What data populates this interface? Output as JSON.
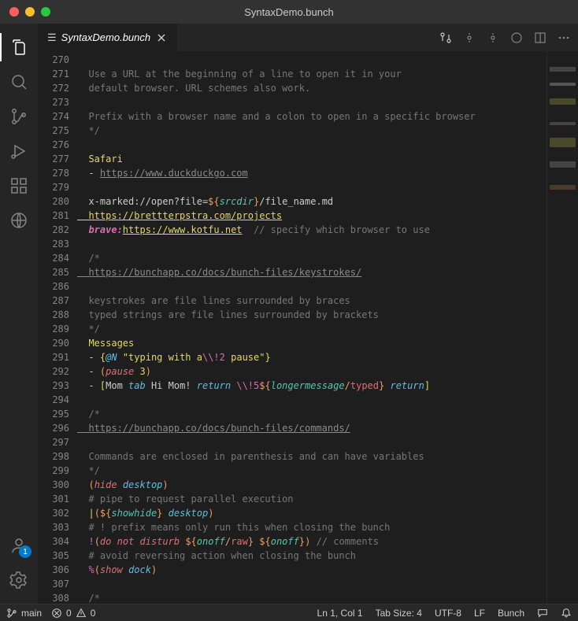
{
  "window": {
    "title": "SyntaxDemo.bunch"
  },
  "tab": {
    "label": "SyntaxDemo.bunch"
  },
  "account": {
    "badge": "1"
  },
  "gutter_start": 270,
  "code_lines": [
    [
      {
        "c": "c-plain",
        "t": "  "
      }
    ],
    [
      {
        "c": "c-comment",
        "t": "  Use a URL at the beginning of a line to open it in your"
      }
    ],
    [
      {
        "c": "c-comment",
        "t": "  default browser. URL schemes also work."
      }
    ],
    [
      {
        "c": "c-plain",
        "t": ""
      }
    ],
    [
      {
        "c": "c-comment",
        "t": "  Prefix with a browser name and a colon to open in a specific browser"
      }
    ],
    [
      {
        "c": "c-comment",
        "t": "  */"
      }
    ],
    [
      {
        "c": "c-plain",
        "t": ""
      }
    ],
    [
      {
        "c": "c-app",
        "t": "  Safari"
      }
    ],
    [
      {
        "c": "c-dash",
        "t": "  - "
      },
      {
        "c": "c-url",
        "t": "https://www.duckduckgo.com"
      }
    ],
    [
      {
        "c": "c-plain",
        "t": ""
      }
    ],
    [
      {
        "c": "c-plain",
        "t": "  x-marked://open?file="
      },
      {
        "c": "c-orange",
        "t": "${"
      },
      {
        "c": "c-var",
        "t": "srcdir"
      },
      {
        "c": "c-orange",
        "t": "}"
      },
      {
        "c": "c-plain",
        "t": "/file_name.md"
      }
    ],
    [
      {
        "c": "c-yellowunder",
        "t": "  https://brettterpstra.com/projects"
      }
    ],
    [
      {
        "c": "c-pinkital c-bold",
        "t": "  brave:"
      },
      {
        "c": "c-yellowunder",
        "t": "https://www.kotfu.net"
      },
      {
        "c": "c-plain",
        "t": "  "
      },
      {
        "c": "c-comment",
        "t": "// specify which browser to use"
      }
    ],
    [
      {
        "c": "c-plain",
        "t": ""
      }
    ],
    [
      {
        "c": "c-comment",
        "t": "  /*"
      }
    ],
    [
      {
        "c": "c-url",
        "t": "  https://bunchapp.co/docs/bunch-files/keystrokes/"
      }
    ],
    [
      {
        "c": "c-plain",
        "t": ""
      }
    ],
    [
      {
        "c": "c-comment",
        "t": "  keystrokes are file lines surrounded by braces"
      }
    ],
    [
      {
        "c": "c-comment",
        "t": "  typed strings are file lines surrounded by brackets"
      }
    ],
    [
      {
        "c": "c-comment",
        "t": "  */"
      }
    ],
    [
      {
        "c": "c-app",
        "t": "  Messages"
      }
    ],
    [
      {
        "c": "c-dash",
        "t": "  - "
      },
      {
        "c": "c-yellow",
        "t": "{"
      },
      {
        "c": "c-cyanital",
        "t": "@N "
      },
      {
        "c": "c-yellow",
        "t": "\"typing with a"
      },
      {
        "c": "c-pink",
        "t": "\\\\!2"
      },
      {
        "c": "c-yellow",
        "t": " pause\""
      },
      {
        "c": "c-yellow",
        "t": "}"
      }
    ],
    [
      {
        "c": "c-dash",
        "t": "  - "
      },
      {
        "c": "c-orange",
        "t": "("
      },
      {
        "c": "c-redbold c-ital",
        "t": "pause"
      },
      {
        "c": "c-plain",
        "t": " "
      },
      {
        "c": "c-yellow",
        "t": "3"
      },
      {
        "c": "c-orange",
        "t": ")"
      }
    ],
    [
      {
        "c": "c-dash",
        "t": "  - "
      },
      {
        "c": "c-yellow",
        "t": "["
      },
      {
        "c": "c-plain",
        "t": "Mom "
      },
      {
        "c": "c-cyanital",
        "t": "tab"
      },
      {
        "c": "c-plain",
        "t": " Hi Mom! "
      },
      {
        "c": "c-cyanital",
        "t": "return"
      },
      {
        "c": "c-plain",
        "t": " "
      },
      {
        "c": "c-pink",
        "t": "\\\\!5"
      },
      {
        "c": "c-orange",
        "t": "${"
      },
      {
        "c": "c-var",
        "t": "longermessage"
      },
      {
        "c": "c-orange",
        "t": "/"
      },
      {
        "c": "c-red",
        "t": "typed"
      },
      {
        "c": "c-orange",
        "t": "}"
      },
      {
        "c": "c-plain",
        "t": " "
      },
      {
        "c": "c-cyanital",
        "t": "return"
      },
      {
        "c": "c-yellow",
        "t": "]"
      }
    ],
    [
      {
        "c": "c-plain",
        "t": ""
      }
    ],
    [
      {
        "c": "c-comment",
        "t": "  /*"
      }
    ],
    [
      {
        "c": "c-url",
        "t": "  https://bunchapp.co/docs/bunch-files/commands/"
      }
    ],
    [
      {
        "c": "c-plain",
        "t": ""
      }
    ],
    [
      {
        "c": "c-comment",
        "t": "  Commands are enclosed in parenthesis and can have variables"
      }
    ],
    [
      {
        "c": "c-comment",
        "t": "  */"
      }
    ],
    [
      {
        "c": "c-orange",
        "t": "  ("
      },
      {
        "c": "c-redbold c-ital",
        "t": "hide"
      },
      {
        "c": "c-plain",
        "t": " "
      },
      {
        "c": "c-cyanital",
        "t": "desktop"
      },
      {
        "c": "c-orange",
        "t": ")"
      }
    ],
    [
      {
        "c": "c-comment",
        "t": "  # pipe to request parallel execution"
      }
    ],
    [
      {
        "c": "c-yellow",
        "t": "  |"
      },
      {
        "c": "c-orange",
        "t": "("
      },
      {
        "c": "c-orange",
        "t": "${"
      },
      {
        "c": "c-var",
        "t": "showhide"
      },
      {
        "c": "c-orange",
        "t": "}"
      },
      {
        "c": "c-plain",
        "t": " "
      },
      {
        "c": "c-cyanital",
        "t": "desktop"
      },
      {
        "c": "c-orange",
        "t": ")"
      }
    ],
    [
      {
        "c": "c-comment",
        "t": "  # ! prefix means only run this when closing the bunch"
      }
    ],
    [
      {
        "c": "c-pink",
        "t": "  !"
      },
      {
        "c": "c-orange",
        "t": "("
      },
      {
        "c": "c-redbold c-ital",
        "t": "do not disturb"
      },
      {
        "c": "c-plain",
        "t": " "
      },
      {
        "c": "c-orange",
        "t": "${"
      },
      {
        "c": "c-var",
        "t": "onoff"
      },
      {
        "c": "c-orange",
        "t": "/"
      },
      {
        "c": "c-red",
        "t": "raw"
      },
      {
        "c": "c-orange",
        "t": "}"
      },
      {
        "c": "c-plain",
        "t": " "
      },
      {
        "c": "c-orange",
        "t": "${"
      },
      {
        "c": "c-var",
        "t": "onoff"
      },
      {
        "c": "c-orange",
        "t": "}"
      },
      {
        "c": "c-orange",
        "t": ")"
      },
      {
        "c": "c-plain",
        "t": " "
      },
      {
        "c": "c-comment",
        "t": "// comments"
      }
    ],
    [
      {
        "c": "c-comment",
        "t": "  # avoid reversing action when closing the bunch"
      }
    ],
    [
      {
        "c": "c-magenta",
        "t": "  %"
      },
      {
        "c": "c-orange",
        "t": "("
      },
      {
        "c": "c-redbold c-ital",
        "t": "show"
      },
      {
        "c": "c-plain",
        "t": " "
      },
      {
        "c": "c-cyanital",
        "t": "dock"
      },
      {
        "c": "c-orange",
        "t": ")"
      }
    ],
    [
      {
        "c": "c-plain",
        "t": ""
      }
    ],
    [
      {
        "c": "c-comment",
        "t": "  /*"
      }
    ]
  ],
  "status": {
    "branch": "main",
    "errors": "0",
    "warnings": "0",
    "cursor": "Ln 1, Col 1",
    "tab_size": "Tab Size: 4",
    "encoding": "UTF-8",
    "eol": "LF",
    "language": "Bunch"
  }
}
